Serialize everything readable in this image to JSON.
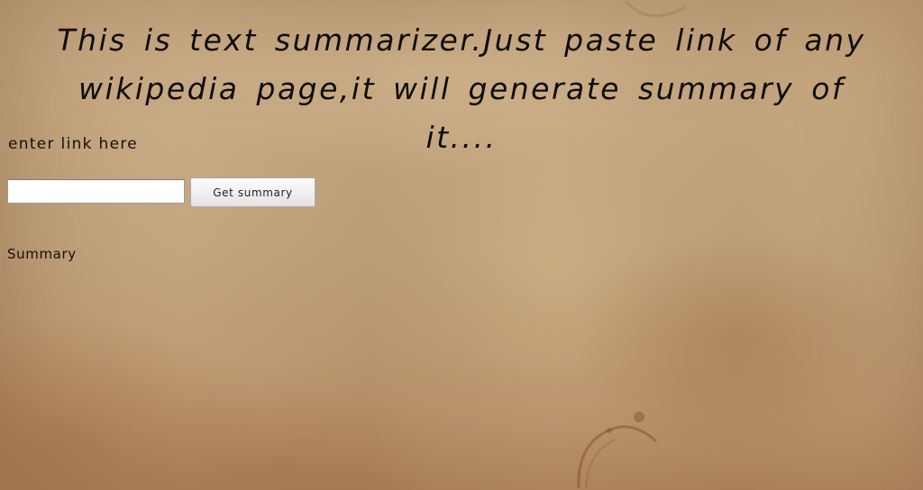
{
  "headline": {
    "text": "This is text summarizer.Just paste link of any wikipedia page,it will generate summary of it...."
  },
  "form": {
    "link_label": "enter link here",
    "link_input_value": "",
    "submit_label": "Get summary"
  },
  "output": {
    "heading": "Summary"
  },
  "colors": {
    "background": "#c4a47c",
    "text": "#111111",
    "button_bg": "#f0f0f0",
    "input_bg": "#ffffff"
  }
}
